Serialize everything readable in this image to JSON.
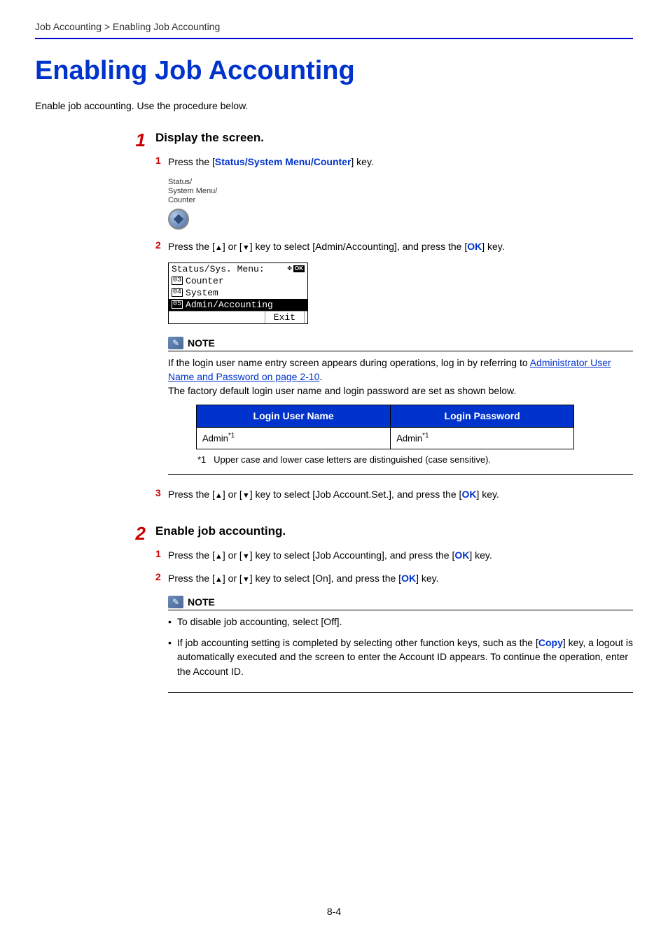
{
  "breadcrumb": "Job Accounting > Enabling Job Accounting",
  "page_title": "Enabling Job Accounting",
  "intro": "Enable job accounting. Use the procedure below.",
  "sections": [
    {
      "number": "1",
      "heading": "Display the screen.",
      "steps": [
        {
          "number": "1",
          "prefix": "Press the [",
          "key": "Status/System Menu/Counter",
          "suffix": "] key."
        },
        {
          "number": "2",
          "prefix": "Press the [",
          "mid1": "] or [",
          "mid2": "] key to select [Admin/Accounting], and press the [",
          "key": "OK",
          "suffix": "] key."
        },
        {
          "number": "3",
          "prefix": "Press the [",
          "mid1": "] or [",
          "mid2": "] key to select [Job Account.Set.], and press the [",
          "key": "OK",
          "suffix": "] key."
        }
      ]
    },
    {
      "number": "2",
      "heading": "Enable job accounting.",
      "steps": [
        {
          "number": "1",
          "prefix": "Press the [",
          "mid1": "] or [",
          "mid2": "] key to select [Job Accounting], and press the [",
          "key": "OK",
          "suffix": "] key."
        },
        {
          "number": "2",
          "prefix": "Press the [",
          "mid1": "] or [",
          "mid2": "] key to select [On], and press the [",
          "key": "OK",
          "suffix": "] key."
        }
      ]
    }
  ],
  "button_label": {
    "line1": "Status/",
    "line2": "System Menu/",
    "line3": "Counter"
  },
  "lcd": {
    "title": "Status/Sys. Menu:",
    "ok": "OK",
    "rows": [
      {
        "num": "03",
        "text": "Counter"
      },
      {
        "num": "04",
        "text": "System"
      },
      {
        "num": "05",
        "text": "Admin/Accounting"
      }
    ],
    "exit": "Exit"
  },
  "note1": {
    "title": "NOTE",
    "line1": "If the login user name entry screen appears during operations, log in by referring to ",
    "link": "Administrator User Name and Password on page 2-10",
    "line1_suffix": ".",
    "line2": "The factory default login user name and login password are set as shown below.",
    "table": {
      "header1": "Login User Name",
      "header2": "Login Password",
      "cell1": "Admin",
      "cell2": "Admin",
      "marker": "*1"
    },
    "footnote_marker": "*1",
    "footnote": "Upper case and lower case letters are distinguished (case sensitive)."
  },
  "note2": {
    "title": "NOTE",
    "bullets": [
      {
        "text": "To disable job accounting, select [Off]."
      },
      {
        "prefix": "If job accounting setting is completed by selecting other function keys, such as the [",
        "key": "Copy",
        "suffix": "] key, a logout is automatically executed and the screen to enter the Account ID appears. To continue the operation, enter the Account ID."
      }
    ]
  },
  "page_number": "8-4"
}
